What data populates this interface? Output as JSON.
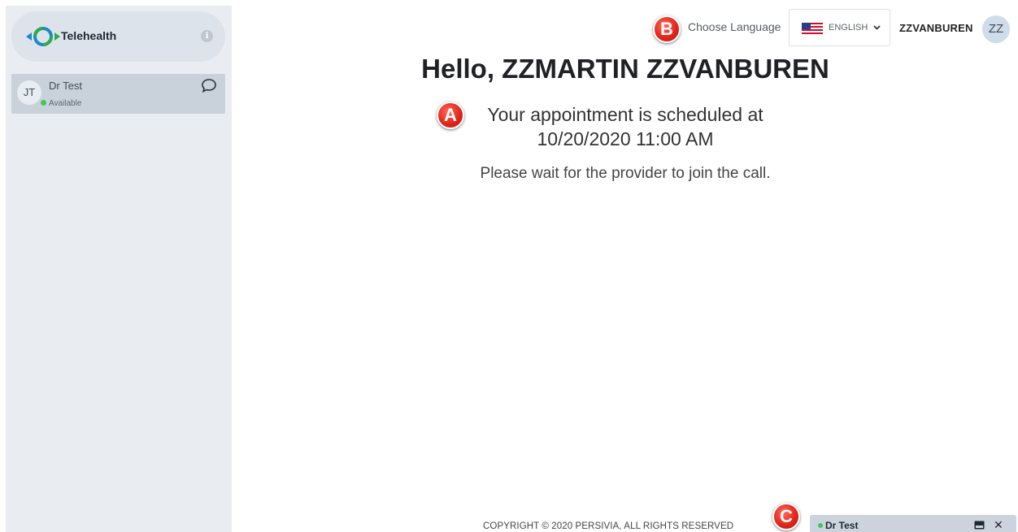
{
  "sidebar": {
    "brand": {
      "name": "Telehealth",
      "logo_icon": "telehealth-logo",
      "info_icon": "info-icon"
    },
    "contacts": [
      {
        "initials": "JT",
        "name": "Dr Test",
        "status": "Available",
        "status_color": "#3dc95a"
      }
    ]
  },
  "header": {
    "choose_language_label": "Choose Language",
    "language": {
      "flag_icon": "us-flag-icon",
      "selected": "ENGLISH"
    },
    "user": {
      "name": "ZZVANBUREN",
      "initials": "ZZ"
    }
  },
  "main": {
    "greeting": "Hello, ZZMARTIN ZZVANBUREN",
    "appointment_line1": "Your appointment is scheduled at",
    "appointment_line2": "10/20/2020 11:00 AM",
    "wait_message": "Please wait for the provider to join the call."
  },
  "annotations": {
    "a": "A",
    "b": "B",
    "c": "C",
    "color": "#e3261b"
  },
  "footer": {
    "copyright": "COPYRIGHT © 2020 PERSIVIA, ALL RIGHTS RESERVED"
  },
  "chat_window": {
    "name": "Dr Test",
    "status_color": "#3dc95a"
  }
}
